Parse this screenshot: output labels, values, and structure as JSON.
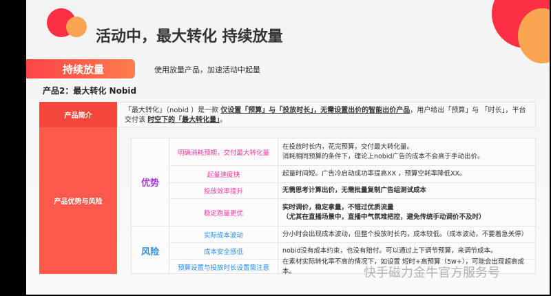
{
  "title": "活动中，最大转化 持续放量",
  "pill": "持续放量",
  "subtitle": "使用放量产品，加速活动中起量",
  "product": "产品2：最大转化 Nobid",
  "intro": {
    "label": "产品简介",
    "p1": "「最大转化」（nobid ）是一款 ",
    "b1": "仅设置「预算」与「投放时长」，无需设置出价的智能出价产品",
    "p2": "，用户给出「预算」与 「时长」，平台交付该 ",
    "b2": "时空下的「最大转化量」",
    "p3": "。"
  },
  "section_label": "产品优势与风险",
  "advantages": {
    "label": "优势",
    "rows": [
      {
        "name": "明确消耗预期，交付最大转化量",
        "desc": [
          "在投放时长内，花完预算，交付最大转化量。",
          "消耗相同预算的条件下，理论上nobid广告的成本不会高于手动出价。"
        ]
      },
      {
        "name": "起量速度快",
        "desc": [
          "起量时间短。广告冷启动成功率提高XX ，预算空耗率降低XX。"
        ]
      },
      {
        "name": "投放效率提升",
        "desc": [
          "无需思考计算出价，无需批量复制广告组测试成本"
        ]
      },
      {
        "name": "稳定跑量更优",
        "desc": [
          "实时调价，稳定拿量，不错过优质流量",
          "（尤其在直播场景中，直播中气氛难把控，避免传统手动调价不及时）"
        ]
      }
    ]
  },
  "risks": {
    "label": "风险",
    "rows": [
      {
        "name": "实际成本波动",
        "desc": [
          "分小时会出现成本波动，但整个投放时长内，成本较低。（成本波动，不要着急关停）"
        ]
      },
      {
        "name": "成本安全感低",
        "desc": [
          "nobid没有成本约束，也没有赔付。可以通过上下调节预算，来调节成本。"
        ]
      },
      {
        "name": "预算设置与投放时长设置需注意",
        "desc": [
          "在素材实际转化率不高的情况下，如设置 短时+高预算（5w+），可能会出现超高成本。"
        ]
      }
    ]
  },
  "watermark": "快手磁力金牛官方服务号"
}
